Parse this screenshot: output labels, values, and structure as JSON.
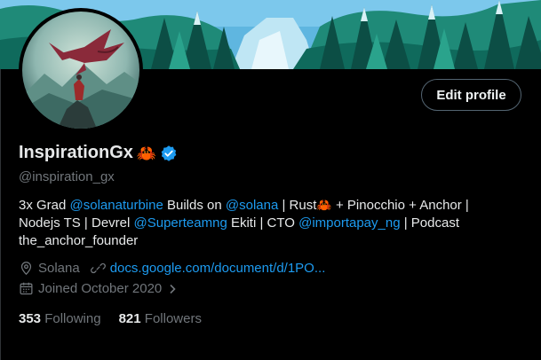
{
  "profile": {
    "display_name": "InspirationGx",
    "name_emoji": "🦀",
    "handle": "@inspiration_gx",
    "edit_profile_label": "Edit profile"
  },
  "bio": {
    "line1_a": "3x Grad ",
    "mention1": "@solanaturbine",
    "line1_b": " Builds on ",
    "mention2": "@solana",
    "line1_c": " | Rust",
    "crab": "🦀",
    "line1_d": " + Pinocchio + Anchor |",
    "line2_a": "Nodejs TS | Devrel ",
    "mention3": "@Superteamng",
    "line2_b": " Ekiti | CTO ",
    "mention4": "@importapay_ng",
    "line2_c": " | Podcast",
    "line3": "the_anchor_founder"
  },
  "meta": {
    "location": "Solana",
    "website": "docs.google.com/document/d/1PO...",
    "joined": "Joined October 2020"
  },
  "stats": {
    "following_count": "353",
    "following_label": "Following",
    "followers_count": "821",
    "followers_label": "Followers"
  },
  "colors": {
    "accent": "#1d9bf0",
    "muted": "#71767b",
    "background": "#000000"
  },
  "icons": [
    "verified-badge-icon",
    "location-icon",
    "link-icon",
    "calendar-icon",
    "chevron-right-icon"
  ]
}
